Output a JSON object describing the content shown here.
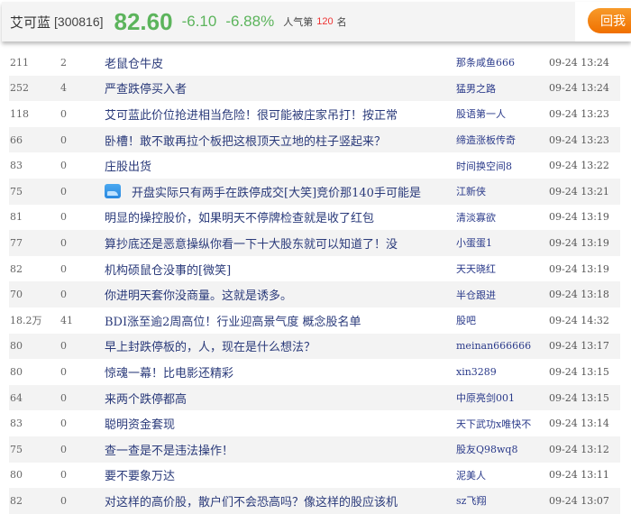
{
  "header": {
    "name": "艾可蓝",
    "code": "[300816]",
    "price": "82.60",
    "change": "-6.10",
    "change_pct": "-6.88%",
    "popularity_label": "人气第",
    "rank": "120",
    "rank_suffix": "名",
    "post_button": "回我"
  },
  "colors": {
    "down": "#5cb45c",
    "rank": "#e33333",
    "accent": "#f07000"
  },
  "posts": [
    {
      "reads": "211",
      "replies": "2",
      "title": "老鼠仓牛皮",
      "author": "那条咸鱼666",
      "time": "09-24 13:24"
    },
    {
      "reads": "252",
      "replies": "4",
      "title": "严查跌停买入者",
      "author": "猛男之路",
      "time": "09-24 13:24"
    },
    {
      "reads": "118",
      "replies": "0",
      "title": "艾可蓝此价位抢进相当危险！很可能被庄家吊打！按正常",
      "author": "股语第一人",
      "time": "09-24 13:23"
    },
    {
      "reads": "66",
      "replies": "0",
      "title": "卧槽！敢不敢再拉个板把这根顶天立地的柱子竖起来？",
      "author": "缔造涨板传奇",
      "time": "09-24 13:23"
    },
    {
      "reads": "83",
      "replies": "0",
      "title": "庄股出货",
      "author": "时间换空间8",
      "time": "09-24 13:22"
    },
    {
      "reads": "75",
      "replies": "0",
      "title": "开盘实际只有两手在跌停成交[大笑]竞价那140手可能是",
      "author": "江新侠",
      "time": "09-24 13:21",
      "has_image": true
    },
    {
      "reads": "81",
      "replies": "0",
      "title": "明显的操控股价，如果明天不停牌检查就是收了红包",
      "author": "清淡寡欲",
      "time": "09-24 13:19"
    },
    {
      "reads": "77",
      "replies": "0",
      "title": "算抄底还是恶意操纵你看一下十大股东就可以知道了！没",
      "author": "小蛋蛋1",
      "time": "09-24 13:19"
    },
    {
      "reads": "82",
      "replies": "0",
      "title": "机构硕鼠仓没事的[微笑]",
      "author": "天天晓红",
      "time": "09-24 13:19"
    },
    {
      "reads": "70",
      "replies": "0",
      "title": "你进明天套你没商量。这就是诱多。",
      "author": "半仓跟进",
      "time": "09-24 13:18"
    },
    {
      "reads": "18.2万",
      "replies": "41",
      "title": "BDI涨至逾2周高位！行业迎高景气度 概念股名单",
      "author": "股吧",
      "time": "09-24 14:32"
    },
    {
      "reads": "80",
      "replies": "0",
      "title": "早上封跌停板的，人，现在是什么想法？",
      "author": "meinan666666",
      "time": "09-24 13:17"
    },
    {
      "reads": "80",
      "replies": "0",
      "title": "惊魂一幕！比电影还精彩",
      "author": "xin3289",
      "time": "09-24 13:15"
    },
    {
      "reads": "64",
      "replies": "0",
      "title": "来两个跌停都高",
      "author": "中原亮剑001",
      "time": "09-24 13:15"
    },
    {
      "reads": "83",
      "replies": "0",
      "title": "聪明资金套现",
      "author": "天下武功x唯快不",
      "time": "09-24 13:14"
    },
    {
      "reads": "75",
      "replies": "0",
      "title": "查一查是不是违法操作！",
      "author": "股友Q98wq8",
      "time": "09-24 13:12"
    },
    {
      "reads": "80",
      "replies": "0",
      "title": "要不要象万达",
      "author": "泥美人",
      "time": "09-24 13:11"
    },
    {
      "reads": "82",
      "replies": "0",
      "title": "对这样的高价股，散户们不会恐高吗？像这样的股应该机",
      "author": "sz飞翔",
      "time": "09-24 13:07"
    }
  ]
}
